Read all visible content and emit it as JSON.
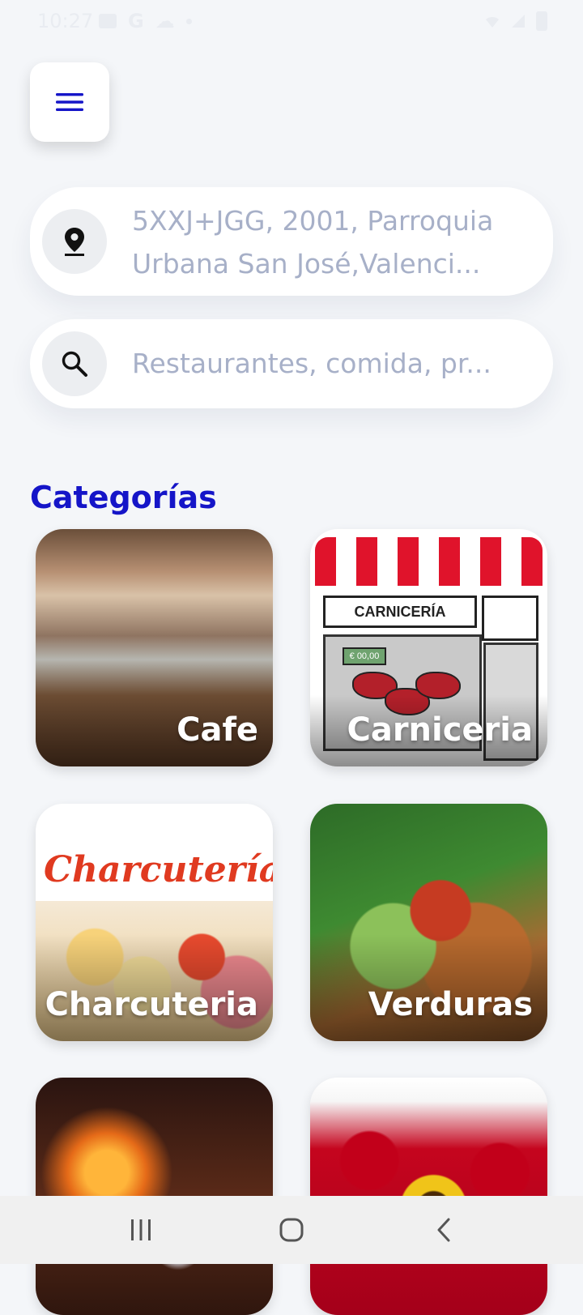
{
  "status_bar": {
    "time": "10:27",
    "icons": [
      "gallery-icon",
      "google-icon",
      "cloud-icon",
      "dot-icon"
    ],
    "right_icons": [
      "wifi-icon",
      "signal-icon",
      "battery-icon"
    ]
  },
  "header": {
    "menu_icon": "hamburger-icon"
  },
  "location": {
    "icon": "location-pin-icon",
    "text": "5XXJ+JGG, 2001, Parroquia Urbana San José,Valenci..."
  },
  "search": {
    "icon": "search-icon",
    "placeholder": "Restaurantes, comida, pr..."
  },
  "categories": {
    "title": "Categorías",
    "items": [
      {
        "label": "Cafe"
      },
      {
        "label": "Carniceria",
        "image": {
          "sign": "CARNICERÍA",
          "price": "€ 00,00"
        }
      },
      {
        "label": "Charcuteria",
        "image": {
          "brand": "Charcutería"
        }
      },
      {
        "label": "Verduras"
      },
      {
        "label": ""
      },
      {
        "label": ""
      }
    ]
  },
  "nav_bar": {
    "buttons": [
      "recents-icon",
      "home-icon",
      "back-icon"
    ]
  },
  "colors": {
    "accent": "#1515c8",
    "placeholder": "#a7b0c8",
    "background": "#f4f6f9"
  }
}
